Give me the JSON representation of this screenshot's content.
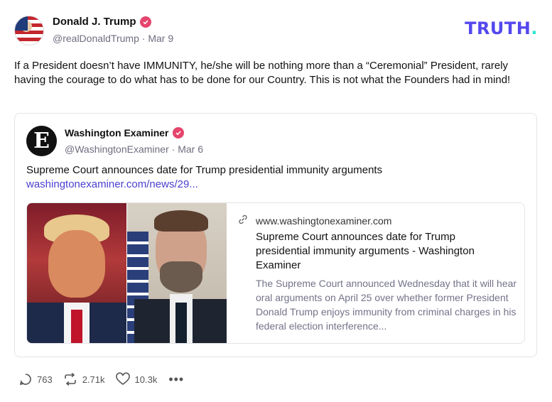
{
  "post": {
    "author_name": "Donald J. Trump",
    "author_handle": "@realDonaldTrump",
    "separator": "·",
    "date": "Mar 9",
    "text": "If a President doesn’t have IMMUNITY, he/she will be nothing more than a “Ceremonial” President, rarely having the courage to do what has to be done for our Country. This is not what the Founders had in mind!"
  },
  "brand": {
    "name": "TRUTH",
    "dot": ".",
    "color": "#5448ee",
    "dot_color": "#2ce6d2"
  },
  "quote": {
    "avatar_letter": "E",
    "author_name": "Washington Examiner",
    "author_handle": "@WashingtonExaminer",
    "separator": "·",
    "date": "Mar 6",
    "text": "Supreme Court announces date for Trump presidential immunity arguments",
    "link": "washingtonexaminer.com/news/29..."
  },
  "link_card": {
    "domain": "www.washingtonexaminer.com",
    "title": "Supreme Court announces date for Trump presidential immunity arguments - Washington Examiner",
    "description": "The Supreme Court announced Wednesday that it will hear oral arguments on April 25 over whether former President Donald Trump enjoys immunity from criminal charges in his federal election interference..."
  },
  "actions": {
    "replies": "763",
    "retruths": "2.71k",
    "likes": "10.3k",
    "more": "•••"
  },
  "colors": {
    "verified": "#e5456d",
    "link": "#4a3fd0",
    "muted": "#6e6e80"
  }
}
